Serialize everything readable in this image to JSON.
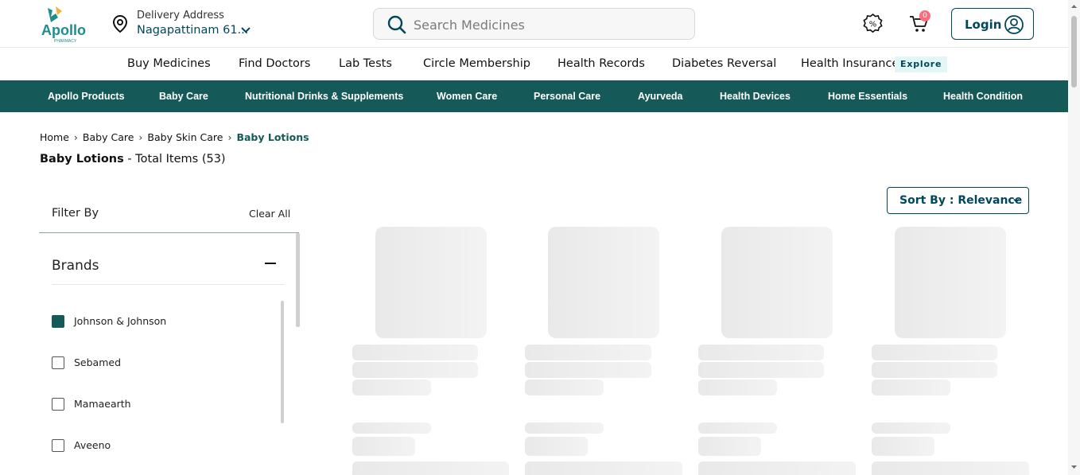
{
  "header": {
    "logo_text": "Apollo",
    "logo_sub": "PHARMACY",
    "delivery_label": "Delivery Address",
    "delivery_value": "Nagapattinam 61...",
    "search_placeholder": "Search Medicines",
    "cart_count": "0",
    "login_label": "Login"
  },
  "main_nav": {
    "items": [
      "Buy Medicines",
      "Find Doctors",
      "Lab Tests",
      "Circle Membership",
      "Health Records",
      "Diabetes Reversal",
      "Health Insurance"
    ],
    "explore_badge": "Explore"
  },
  "category_bar": {
    "items": [
      "Apollo Products",
      "Baby Care",
      "Nutritional Drinks & Supplements",
      "Women Care",
      "Personal Care",
      "Ayurveda",
      "Health Devices",
      "Home Essentials",
      "Health Condition"
    ]
  },
  "breadcrumb": {
    "items": [
      "Home",
      "Baby Care",
      "Baby Skin Care"
    ],
    "current": "Baby Lotions",
    "separator": "›"
  },
  "page": {
    "title": "Baby Lotions",
    "total_text": " - Total Items (53)"
  },
  "sort": {
    "label": "Sort By : Relevance"
  },
  "filter": {
    "title": "Filter By",
    "clear_label": "Clear All",
    "brands_title": "Brands",
    "brands": [
      {
        "label": "Johnson & Johnson",
        "checked": true
      },
      {
        "label": "Sebamed",
        "checked": false
      },
      {
        "label": "Mamaearth",
        "checked": false
      },
      {
        "label": "Aveeno",
        "checked": false
      }
    ]
  },
  "colors": {
    "brand_dark": "#01475b",
    "category_bar": "#155a58",
    "cart_badge": "#fc6d7b",
    "explore_bg": "#e3f6f6"
  },
  "icons": {
    "location": "location-pin-icon",
    "search": "search-icon",
    "offers": "offers-percent-icon",
    "cart": "cart-icon",
    "user": "user-circle-icon"
  }
}
